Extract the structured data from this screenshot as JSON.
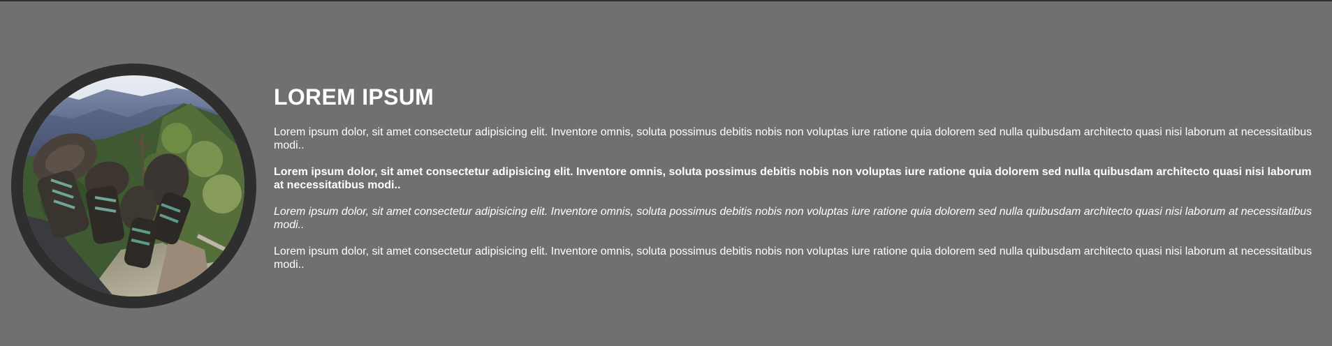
{
  "hero": {
    "image": {
      "alt": "",
      "icon": "hiking-boots-mountain-photo"
    },
    "title": "LOREM IPSUM",
    "paragraphs": [
      "Lorem ipsum dolor, sit amet consectetur adipisicing elit. Inventore omnis, soluta possimus debitis nobis non voluptas iure ratione quia dolorem sed nulla quibusdam architecto quasi nisi laborum at necessitatibus modi..",
      "Lorem ipsum dolor, sit amet consectetur adipisicing elit. Inventore omnis, soluta possimus debitis nobis non voluptas iure ratione quia dolorem sed nulla quibusdam architecto quasi nisi laborum at necessitatibus modi..",
      "Lorem ipsum dolor, sit amet consectetur adipisicing elit. Inventore omnis, soluta possimus debitis nobis non voluptas iure ratione quia dolorem sed nulla quibusdam architecto quasi nisi laborum at necessitatibus modi..",
      "Lorem ipsum dolor, sit amet consectetur adipisicing elit. Inventore omnis, soluta possimus debitis nobis non voluptas iure ratione quia dolorem sed nulla quibusdam architecto quasi nisi laborum at necessitatibus modi.."
    ]
  },
  "colors": {
    "background": "#707070",
    "frame": "#2e2e2e",
    "text": "#ffffff"
  }
}
